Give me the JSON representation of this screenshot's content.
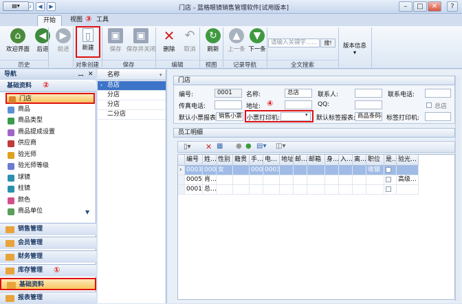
{
  "window": {
    "title": "门店 - 蓝格眼镜销售管理软件[试用版本]",
    "min": "–",
    "max": "□",
    "close": "✕",
    "help": "?"
  },
  "ribbon_tabs": [
    "开始",
    "视图",
    "工具"
  ],
  "ribbon": {
    "home": "欢迎界面",
    "back": "后退",
    "forward": "前进",
    "new": "新建",
    "save": "保存",
    "save_close": "保存并关闭",
    "delete": "删除",
    "cancel": "取消",
    "refresh": "刷新",
    "prev": "上一条",
    "next": "下一条",
    "search_placeholder": "请输入关键字......",
    "search_btn": "搜!",
    "version": "版本信息",
    "groups": {
      "history": "历史",
      "object_create": "对象创建",
      "save": "保存",
      "edit": "编辑",
      "view": "视图",
      "record_nav": "记录导航",
      "fulltext": "全文搜索"
    }
  },
  "annotations": {
    "c1": "①",
    "c2": "②",
    "c3": "③",
    "c4": "④"
  },
  "nav": {
    "title": "导航",
    "pin": "ꟷ",
    "close": "✕",
    "section": "基础资料",
    "items": [
      {
        "label": "门店",
        "color": "#d9822b"
      },
      {
        "label": "商品",
        "color": "#5b8fd6"
      },
      {
        "label": "商品类型",
        "color": "#3c9b4d"
      },
      {
        "label": "商品提成设置",
        "color": "#a066c7"
      },
      {
        "label": "供应商",
        "color": "#c23b3b"
      },
      {
        "label": "验光师",
        "color": "#e0a020"
      },
      {
        "label": "验光师等级",
        "color": "#6a7bd0"
      },
      {
        "label": "球镜",
        "color": "#2b8fb0"
      },
      {
        "label": "柱镜",
        "color": "#2b8fb0"
      },
      {
        "label": "颜色",
        "color": "#d04f8a"
      },
      {
        "label": "商品单位",
        "color": "#5a9e5a"
      }
    ],
    "groups": [
      "销售管理",
      "会员管理",
      "财务管理",
      "库存管理",
      "基础资料",
      "报表管理"
    ]
  },
  "list": {
    "header": "名称",
    "rows": [
      "总店",
      "分店",
      "分店",
      "二分店"
    ]
  },
  "store": {
    "section": "门店",
    "labels": {
      "code": "编号:",
      "name": "名称:",
      "contact": "联系人:",
      "phone": "联系电话:",
      "fax": "传真电话:",
      "address": "地址:",
      "qq": "QQ:",
      "hq": "总店",
      "receipt": "默认小票报表:",
      "printer": "小票打印机:",
      "tag": "默认标签报表:",
      "tag_printer": "标签打印机:"
    },
    "values": {
      "code": "0001",
      "name": "总店",
      "contact": "",
      "phone": "",
      "fax": "",
      "address": "",
      "qq": "",
      "receipt": "销售小票",
      "printer": "",
      "tag": "商品条码标",
      "tag_printer": ""
    }
  },
  "staff": {
    "section": "员工明细",
    "columns": [
      "编号",
      "姓…",
      "性别",
      "籍贯",
      "手…",
      "电…",
      "地址",
      "邮…",
      "邮箱",
      "身…",
      "入…",
      "离…",
      "职位",
      "是…",
      "验光…"
    ],
    "rows": [
      {
        "c": [
          "0003",
          "0003",
          "女",
          "",
          "0003",
          "0003",
          "",
          "",
          "",
          "",
          "",
          "",
          "收银",
          "",
          ""
        ],
        "selected": true
      },
      {
        "c": [
          "0005",
          "肖…",
          "",
          "",
          "",
          "",
          "",
          "",
          "",
          "",
          "",
          "",
          "",
          "",
          "高级…"
        ],
        "selected": false
      },
      {
        "c": [
          "0001",
          "总…",
          "",
          "",
          "",
          "",
          "",
          "",
          "",
          "",
          "",
          "",
          "",
          "",
          ""
        ],
        "selected": false
      }
    ]
  }
}
